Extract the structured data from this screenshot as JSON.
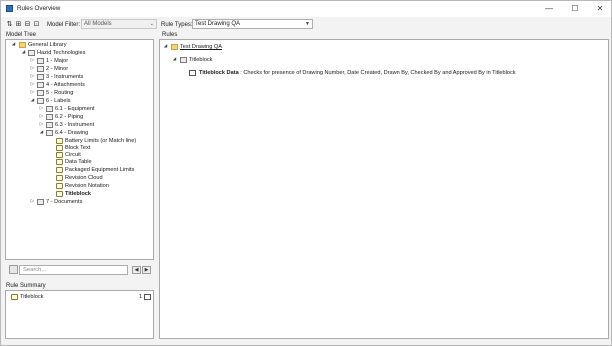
{
  "window": {
    "title": "Rules Overview",
    "minimize": "—",
    "maximize": "☐",
    "close": "✕"
  },
  "toolbar": {
    "model_filter_label": "Model Filter:",
    "model_filter_value": "All Models",
    "rule_types_label": "Rule Types:",
    "rule_types_value": "Test Drawing QA",
    "icons": [
      "tree-expand-icon",
      "tree-collapse-icon",
      "tree-filter-icon",
      "tree-refresh-icon"
    ]
  },
  "model_tree": {
    "header": "Model Tree",
    "items": [
      {
        "label": "General Library"
      },
      {
        "label": "Hazid Technologies"
      },
      {
        "label": "1 - Major"
      },
      {
        "label": "2 - Minor"
      },
      {
        "label": "3 - Instruments"
      },
      {
        "label": "4 - Attachments"
      },
      {
        "label": "5 - Routing"
      },
      {
        "label": "6 - Labels"
      },
      {
        "label": "6.1 - Equipment"
      },
      {
        "label": "6.2 - Piping"
      },
      {
        "label": "6.3 - Instrument"
      },
      {
        "label": "6.4 - Drawing"
      },
      {
        "label": "Battery Limits (or Match line)"
      },
      {
        "label": "Block Text"
      },
      {
        "label": "Circuit"
      },
      {
        "label": "Data Table"
      },
      {
        "label": "Packaged Equipment Limits"
      },
      {
        "label": "Revision Cloud"
      },
      {
        "label": "Revision Notation"
      },
      {
        "label": "Titleblock"
      },
      {
        "label": "7 - Documents"
      }
    ],
    "search_placeholder": "Search..."
  },
  "rule_summary": {
    "header": "Rule Summary",
    "items": [
      {
        "label": "Titleblock",
        "count": "1"
      }
    ]
  },
  "rules": {
    "header": "Rules",
    "items": [
      {
        "label": "Test Drawing QA"
      },
      {
        "label": "Titleblock"
      },
      {
        "bold": "Titleblock Data",
        "text": " : Checks for presence of Drawing Number, Date Created, Drawn By, Checked By and Approved By in Titleblock"
      }
    ]
  }
}
